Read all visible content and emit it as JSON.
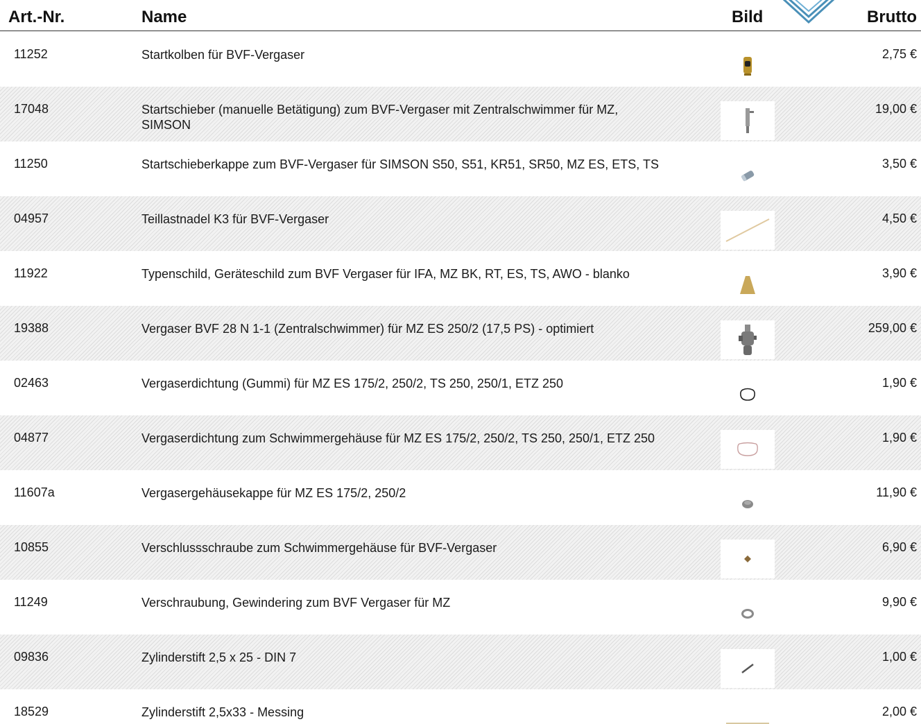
{
  "headers": {
    "artnr": "Art.-Nr.",
    "name": "Name",
    "bild": "Bild",
    "brutto": "Brutto"
  },
  "colors": {
    "logo_blue": "#4a90b8",
    "header_rule": "#333333",
    "stripe": "#f2f2f2"
  },
  "rows": [
    {
      "artnr": "11252",
      "name": "Startkolben für BVF-Vergaser",
      "price": "2,75 €",
      "icon": "brass-piston-icon"
    },
    {
      "artnr": "17048",
      "name": "Startschieber (manuelle Betätigung) zum BVF-Vergaser mit Zentralschwimmer für MZ, SIMSON",
      "price": "19,00 €",
      "icon": "slide-valve-icon"
    },
    {
      "artnr": "11250",
      "name": "Startschieberkappe zum BVF-Vergaser für SIMSON S50, S51, KR51, SR50, MZ ES, ETS, TS",
      "price": "3,50 €",
      "icon": "cap-icon"
    },
    {
      "artnr": "04957",
      "name": "Teillastnadel K3 für BVF-Vergaser",
      "price": "4,50 €",
      "icon": "needle-icon"
    },
    {
      "artnr": "11922",
      "name": "Typenschild, Geräteschild zum BVF Vergaser für IFA, MZ BK, RT, ES, TS, AWO - blanko",
      "price": "3,90 €",
      "icon": "nameplate-icon"
    },
    {
      "artnr": "19388",
      "name": "Vergaser BVF 28 N 1-1 (Zentralschwimmer) für MZ ES 250/2 (17,5 PS) - optimiert",
      "price": "259,00 €",
      "icon": "carburetor-icon"
    },
    {
      "artnr": "02463",
      "name": "Vergaserdichtung (Gummi) für MZ ES 175/2, 250/2, TS 250, 250/1, ETZ 250",
      "price": "1,90 €",
      "icon": "rubber-gasket-icon"
    },
    {
      "artnr": "04877",
      "name": "Vergaserdichtung zum Schwimmergehäuse für MZ ES 175/2, 250/2, TS 250, 250/1, ETZ 250",
      "price": "1,90 €",
      "icon": "float-gasket-icon"
    },
    {
      "artnr": "11607a",
      "name": "Vergasergehäusekappe für MZ ES 175/2, 250/2",
      "price": "11,90 €",
      "icon": "housing-cap-icon"
    },
    {
      "artnr": "10855",
      "name": "Verschlussschraube zum Schwimmergehäuse für BVF-Vergaser",
      "price": "6,90 €",
      "icon": "plug-screw-icon"
    },
    {
      "artnr": "11249",
      "name": "Verschraubung, Gewindering zum BVF Vergaser für MZ",
      "price": "9,90 €",
      "icon": "threaded-ring-icon"
    },
    {
      "artnr": "09836",
      "name": "Zylinderstift 2,5 x 25 - DIN 7",
      "price": "1,00 €",
      "icon": "cylinder-pin-icon"
    },
    {
      "artnr": "18529",
      "name": "Zylinderstift 2,5x33 - Messing",
      "price": "2,00 €",
      "icon": "brass-pin-icon"
    }
  ]
}
